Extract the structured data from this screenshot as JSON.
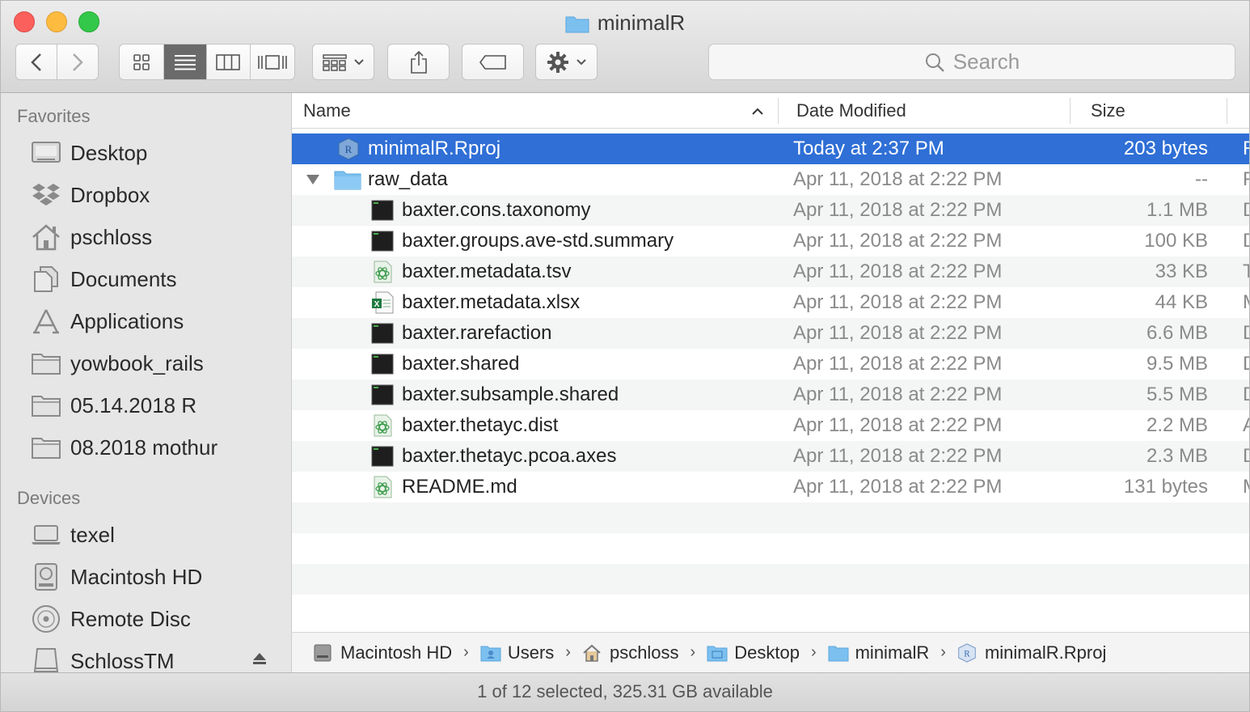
{
  "window": {
    "title": "minimalR"
  },
  "toolbar": {
    "search_placeholder": "Search"
  },
  "sidebar": {
    "favorites_header": "Favorites",
    "favorites": [
      {
        "label": "Desktop"
      },
      {
        "label": "Dropbox"
      },
      {
        "label": "pschloss"
      },
      {
        "label": "Documents"
      },
      {
        "label": "Applications"
      },
      {
        "label": "yowbook_rails"
      },
      {
        "label": "05.14.2018 R"
      },
      {
        "label": "08.2018 mothur"
      }
    ],
    "devices_header": "Devices",
    "devices": [
      {
        "label": "texel"
      },
      {
        "label": "Macintosh HD"
      },
      {
        "label": "Remote Disc"
      },
      {
        "label": "SchlossTM"
      }
    ]
  },
  "columns": {
    "name": "Name",
    "date": "Date Modified",
    "size": "Size"
  },
  "files": [
    {
      "name": "minimalR.Rproj",
      "date": "Today at 2:37 PM",
      "size": "203 bytes",
      "kind": "R",
      "icon": "rproj-icon",
      "selected": true
    },
    {
      "name": "raw_data",
      "date": "Apr 11, 2018 at 2:22 PM",
      "size": "--",
      "kind": "F",
      "icon": "folder-icon"
    },
    {
      "name": "baxter.cons.taxonomy",
      "date": "Apr 11, 2018 at 2:22 PM",
      "size": "1.1 MB",
      "kind": "D",
      "icon": "terminal-doc-icon"
    },
    {
      "name": "baxter.groups.ave-std.summary",
      "date": "Apr 11, 2018 at 2:22 PM",
      "size": "100 KB",
      "kind": "D",
      "icon": "terminal-doc-icon"
    },
    {
      "name": "baxter.metadata.tsv",
      "date": "Apr 11, 2018 at 2:22 PM",
      "size": "33 KB",
      "kind": "T",
      "icon": "atom-doc-icon"
    },
    {
      "name": "baxter.metadata.xlsx",
      "date": "Apr 11, 2018 at 2:22 PM",
      "size": "44 KB",
      "kind": "M",
      "icon": "excel-doc-icon"
    },
    {
      "name": "baxter.rarefaction",
      "date": "Apr 11, 2018 at 2:22 PM",
      "size": "6.6 MB",
      "kind": "D",
      "icon": "terminal-doc-icon"
    },
    {
      "name": "baxter.shared",
      "date": "Apr 11, 2018 at 2:22 PM",
      "size": "9.5 MB",
      "kind": "D",
      "icon": "terminal-doc-icon"
    },
    {
      "name": "baxter.subsample.shared",
      "date": "Apr 11, 2018 at 2:22 PM",
      "size": "5.5 MB",
      "kind": "D",
      "icon": "terminal-doc-icon"
    },
    {
      "name": "baxter.thetayc.dist",
      "date": "Apr 11, 2018 at 2:22 PM",
      "size": "2.2 MB",
      "kind": "A",
      "icon": "atom-doc-icon"
    },
    {
      "name": "baxter.thetayc.pcoa.axes",
      "date": "Apr 11, 2018 at 2:22 PM",
      "size": "2.3 MB",
      "kind": "D",
      "icon": "terminal-doc-icon"
    },
    {
      "name": "README.md",
      "date": "Apr 11, 2018 at 2:22 PM",
      "size": "131 bytes",
      "kind": "M",
      "icon": "atom-doc-icon"
    }
  ],
  "pathbar": [
    {
      "label": "Macintosh HD",
      "icon": "hard-drive-icon"
    },
    {
      "label": "Users",
      "icon": "users-folder-icon"
    },
    {
      "label": "pschloss",
      "icon": "home-icon"
    },
    {
      "label": "Desktop",
      "icon": "desktop-folder-icon"
    },
    {
      "label": "minimalR",
      "icon": "folder-icon"
    },
    {
      "label": "minimalR.Rproj",
      "icon": "rproj-icon"
    }
  ],
  "status": {
    "text": "1 of 12 selected, 325.31 GB available"
  },
  "colors": {
    "selection": "#2f6fd6",
    "folder": "#6db6ee"
  }
}
